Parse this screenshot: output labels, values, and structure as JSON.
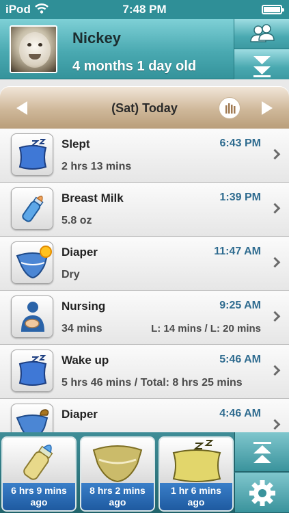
{
  "status_bar": {
    "carrier": "iPod",
    "time": "7:48 PM"
  },
  "profile": {
    "name": "Nickey",
    "age": "4 months 1 day old"
  },
  "date_nav": {
    "label": "(Sat) Today"
  },
  "log_entries": [
    {
      "title": "Slept",
      "time": "6:43 PM",
      "detail": "2 hrs 13 mins",
      "extra": "",
      "icon": "pillow-icon"
    },
    {
      "title": "Breast Milk",
      "time": "1:39 PM",
      "detail": "5.8 oz",
      "extra": "",
      "icon": "bottle-icon"
    },
    {
      "title": "Diaper",
      "time": "11:47 AM",
      "detail": "Dry",
      "extra": "",
      "icon": "diaper-dry-icon"
    },
    {
      "title": "Nursing",
      "time": "9:25 AM",
      "detail": "34 mins",
      "extra": "L: 14 mins / L: 20 mins",
      "icon": "nursing-icon"
    },
    {
      "title": "Wake up",
      "time": "5:46 AM",
      "detail": "5 hrs 46 mins / Total: 8 hrs 25 mins",
      "extra": "",
      "icon": "pillow-icon"
    },
    {
      "title": "Diaper",
      "time": "4:46 AM",
      "detail": "",
      "extra": "",
      "icon": "diaper-dirty-icon"
    }
  ],
  "quick_tiles": [
    {
      "caption_line1": "6 hrs 9 mins",
      "caption_line2": "ago",
      "icon": "bottle-icon"
    },
    {
      "caption_line1": "8 hrs 2 mins",
      "caption_line2": "ago",
      "icon": "diaper-icon"
    },
    {
      "caption_line1": "1 hr 6 mins",
      "caption_line2": "ago",
      "icon": "pillow-icon"
    }
  ],
  "colors": {
    "header_teal": "#4aa9b1",
    "time_blue": "#2e6b8f",
    "caption_blue": "#2a6cb5",
    "date_bar_tan": "#cfb89a"
  }
}
